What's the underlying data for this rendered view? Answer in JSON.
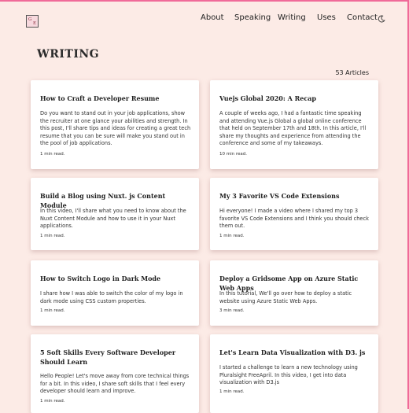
{
  "header": {
    "logo_letters": [
      "G",
      "E"
    ],
    "nav": [
      "About",
      "Speaking",
      "Writing",
      "Uses",
      "Contact"
    ],
    "theme_toggle_icon": "moon-icon"
  },
  "page": {
    "title": "WRITING",
    "count": "53 Articles"
  },
  "articles": [
    {
      "title": "How to Craft a Developer Resume",
      "excerpt": "Do you want to stand out in your job applications, show the recruiter at one glance your abilities and strength. In this post, I'll share tips and ideas for creating a great tech resume that you can be sure will make you stand out in the pool of job applications.",
      "read_time": "1 min read."
    },
    {
      "title": "Vuejs Global 2020: A Recap",
      "excerpt": "A couple of weeks ago, I had a fantastic time speaking and attending Vue.js Global a global online conference that held on September 17th and 18th. In this article, I'll share my thoughts and experience from attending the conference and some of my takeaways.",
      "read_time": "10 min read."
    },
    {
      "title": "Build a Blog using Nuxt. js Content Module",
      "excerpt": "In this video, I'll share what you need to know about the Nuxt Content Module and how to use it in your Nuxt applications.",
      "read_time": "1 min read."
    },
    {
      "title": "My 3 Favorite VS Code Extensions",
      "excerpt": "Hi everyone! I made a video where I shared my top 3 favorite VS Code Extensions and I think you should check them out.",
      "read_time": "1 min read."
    },
    {
      "title": "How to Switch Logo in Dark Mode",
      "excerpt": "I share how I was able to switch the color of my logo in dark mode using CSS custom properties.",
      "read_time": "1 min read."
    },
    {
      "title": "Deploy a Gridsome App on Azure Static Web Apps",
      "excerpt": "In this tutorial, We'll go over how to deploy a static website using Azure Static Web Apps.",
      "read_time": "3 min read."
    },
    {
      "title": "5 Soft Skills Every Software Developer Should Learn",
      "excerpt": "Hello People! Let's move away from core technical things for a bit. In this video, I share soft skills that I feel every developer should learn and improve.",
      "read_time": "1 min read."
    },
    {
      "title": "Let's Learn Data Visualization with D3. js",
      "excerpt": "I started a challenge to learn a new technology using Pluralsight FreeApril. In this video, I get into data visualization with D3.js",
      "read_time": "1 min read."
    }
  ],
  "colors": {
    "background": "#fcebe6",
    "accent": "#f06a99",
    "card": "#ffffff"
  }
}
